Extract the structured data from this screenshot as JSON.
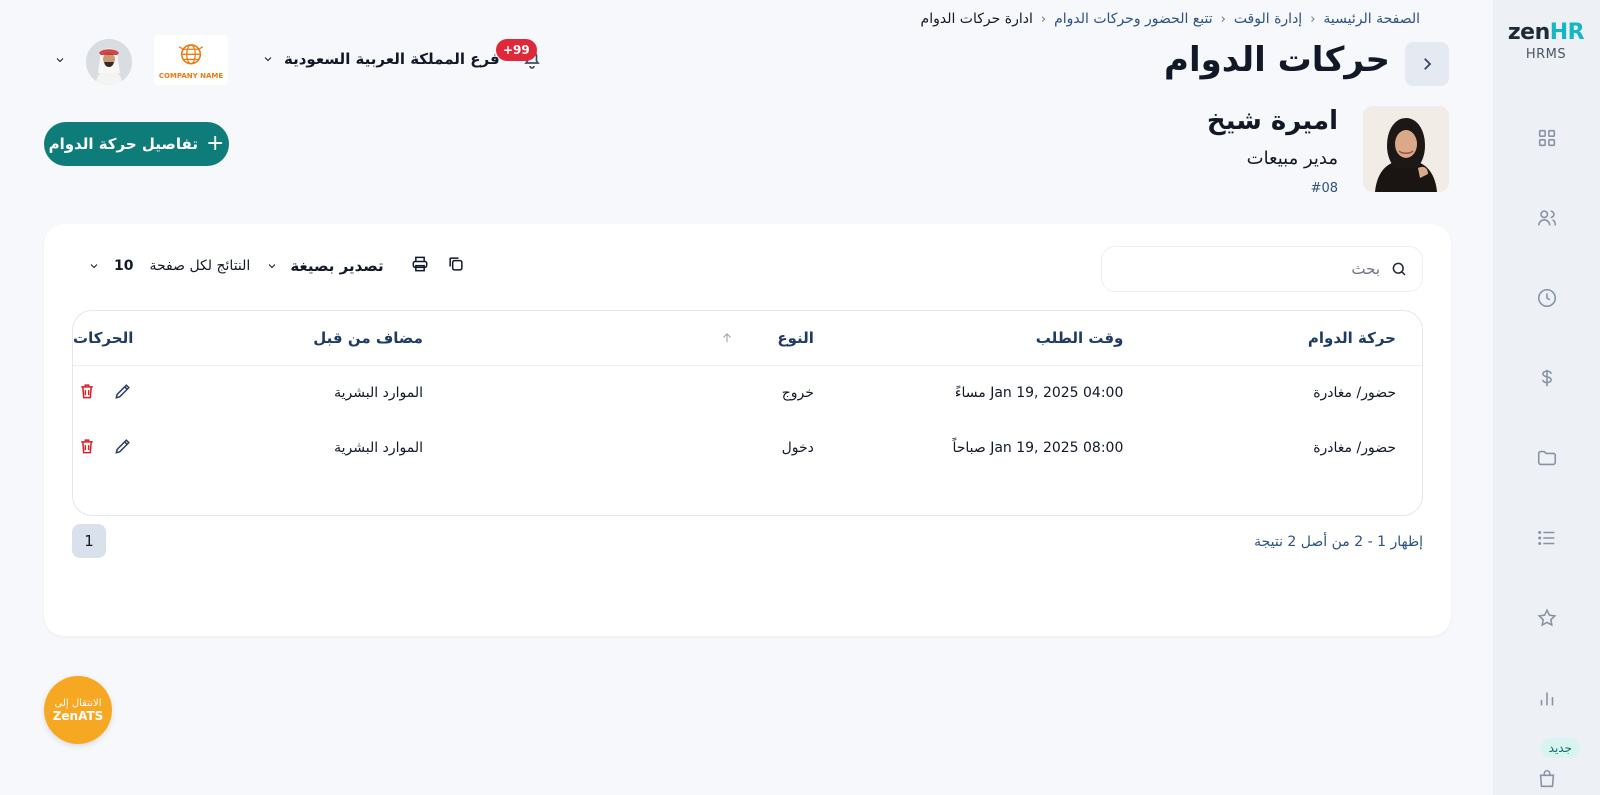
{
  "sidebar": {
    "logo_main": "zen",
    "logo_hr": "HR",
    "logo_sub": "HRMS",
    "new_badge": "جديد",
    "icons": [
      "dashboard-icon",
      "users-icon",
      "clock-icon",
      "dollar-icon",
      "folder-icon",
      "list-icon",
      "star-icon",
      "bar-chart-icon",
      "shopping-bag-icon"
    ]
  },
  "breadcrumb": {
    "items": [
      "الصفحة الرئيسية",
      "إدارة الوقت",
      "تتبع الحضور وحركات الدوام",
      "ادارة حركات الدوام"
    ]
  },
  "page": {
    "title": "حركات الدوام"
  },
  "header": {
    "notif_badge": "+99",
    "branch": "فرع المملكة العربية السعودية",
    "company_name": "COMPANY NAME"
  },
  "employee": {
    "name": "اميرة شيخ",
    "role": "مدير مبيعات",
    "id": "#08"
  },
  "actions": {
    "add_label": "تفاصيل حركة الدوام",
    "add_plus": "+"
  },
  "search": {
    "placeholder": "بحث"
  },
  "toolbar": {
    "export_label": "تصدير بصيغة",
    "per_page_label": "النتائج لكل صفحة",
    "per_page_value": "10"
  },
  "table": {
    "headers": [
      "حركة الدوام",
      "وقت الطلب",
      "النوع",
      "مضاف من قبل",
      "الحركات"
    ],
    "rows": [
      {
        "movement": "حضور/ مغادرة",
        "time": "Jan 19, 2025 04:00 مساءً",
        "type": "خروج",
        "added_by": "الموارد البشرية"
      },
      {
        "movement": "حضور/ مغادرة",
        "time": "Jan 19, 2025 08:00 صباحاً",
        "type": "دخول",
        "added_by": "الموارد البشرية"
      }
    ]
  },
  "pagination": {
    "summary": "إظهار 1 - 2 من أصل 2 نتيجة",
    "current_page": "1"
  },
  "ats": {
    "line1": "الانتقال إلى",
    "line2": "ZenATS"
  },
  "colors": {
    "primary": "#0e7c78",
    "badge_red": "#e0283b",
    "delete_red": "#d81f26",
    "ats_orange": "#f7a823",
    "brand_teal": "#14b8c4"
  }
}
